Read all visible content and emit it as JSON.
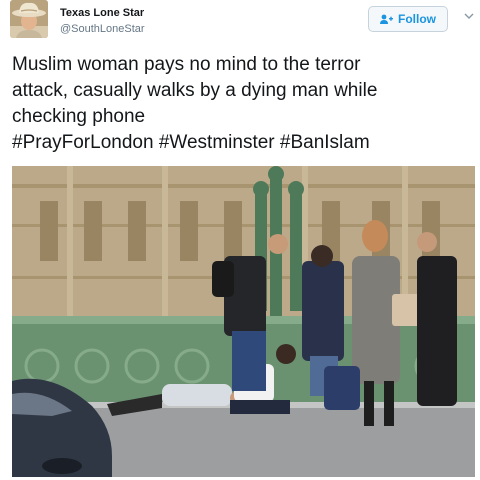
{
  "tweet": {
    "author": {
      "display_name": "Texas Lone Star",
      "handle": "@SouthLoneStar",
      "avatar_icon": "avatar-cowboy-hat"
    },
    "follow_button": {
      "label": "Follow",
      "icon": "add-person-icon",
      "color": "#1b95e0"
    },
    "menu_icon": "chevron-down-icon",
    "text_lines": [
      "Muslim woman pays no mind to the terror",
      "attack, casually walks by a dying man while",
      "checking phone"
    ],
    "hashtags": [
      "#PrayForLondon",
      "#Westminster",
      "#BanIslam"
    ],
    "photo": {
      "description_icon": "photo-westminster-bridge"
    }
  }
}
